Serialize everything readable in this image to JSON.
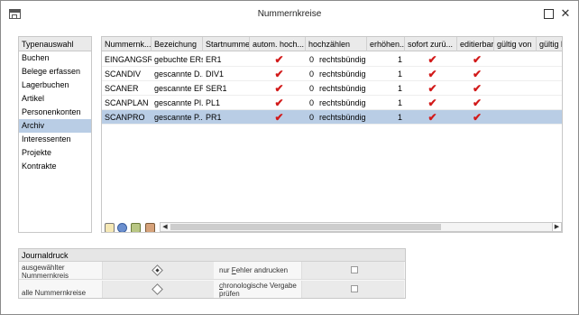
{
  "window": {
    "title": "Nummernkreise"
  },
  "types": {
    "header": "Typenauswahl",
    "items": [
      "Buchen",
      "Belege erfassen",
      "Lagerbuchen",
      "Artikel",
      "Personenkonten",
      "Archiv",
      "Interessenten",
      "Projekte",
      "Kontrakte"
    ],
    "selected": "Archiv"
  },
  "grid": {
    "columns": [
      "Nummernk...",
      "Bezeichung",
      "Startnummer",
      "autom. hoch...",
      "hochzählen",
      "erhöhen...",
      "sofort zurü...",
      "editierbar",
      "gültig von",
      "gültig b"
    ],
    "rows": [
      {
        "nummer": "EINGANGSRG",
        "bez": "gebuchte ERs",
        "start": "ER1",
        "autom": true,
        "hoch_n": "0",
        "hoch_t": "rechtsbündig",
        "erh": "1",
        "sofort": true,
        "edit": true
      },
      {
        "nummer": "SCANDIV",
        "bez": "gescannte D...",
        "start": "DIV1",
        "autom": true,
        "hoch_n": "0",
        "hoch_t": "rechtsbündig",
        "erh": "1",
        "sofort": true,
        "edit": true
      },
      {
        "nummer": "SCANER",
        "bez": "gescannte ERs",
        "start": "SER1",
        "autom": true,
        "hoch_n": "0",
        "hoch_t": "rechtsbündig",
        "erh": "1",
        "sofort": true,
        "edit": true
      },
      {
        "nummer": "SCANPLAN",
        "bez": "gescannte Pl...",
        "start": "PL1",
        "autom": true,
        "hoch_n": "0",
        "hoch_t": "rechtsbündig",
        "erh": "1",
        "sofort": true,
        "edit": true
      },
      {
        "nummer": "SCANPRO",
        "bez": "gescannte P...",
        "start": "PR1",
        "autom": true,
        "hoch_n": "0",
        "hoch_t": "rechtsbündig",
        "erh": "1",
        "sofort": true,
        "edit": true
      }
    ],
    "selected_row": 4,
    "check_glyph": "✔"
  },
  "journal": {
    "header": "Journaldruck",
    "opt_selected_1": "ausgewählter",
    "opt_selected_2": "Nummernkreis",
    "opt_all": "alle Nummernkreise",
    "errors_prefix": "nur ",
    "errors_u": "F",
    "errors_rest": "ehler andrucken",
    "chron_u": "c",
    "chron_rest": "hronologische Vergabe",
    "chron_2": "prüfen"
  },
  "icons": [
    "app-icon",
    "maximize-icon",
    "close-icon",
    "new-record-icon",
    "database-icon",
    "add-icon",
    "edit-icon"
  ]
}
